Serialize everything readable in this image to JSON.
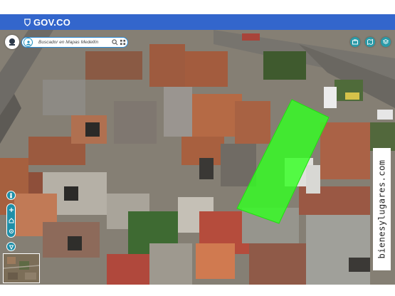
{
  "gov_bar": {
    "logo_text": "GOV.CO",
    "color": "#3366cc",
    "icon": "shield-icon"
  },
  "search": {
    "placeholder": "Buscador en Mapas Medellín",
    "left_icon": "user-icon",
    "search_icon": "search-icon",
    "menu_icon": "grid-menu-icon"
  },
  "map": {
    "type": "aerial-satellite",
    "highlight_color": "#33ff22"
  },
  "tools": [
    "briefcase-icon",
    "map-icon",
    "layers-icon"
  ],
  "controls": [
    "person-icon",
    "zoom-in-icon",
    "home-icon",
    "locate-icon",
    "compass-icon"
  ],
  "watermark": {
    "text": "bienesylugares.com"
  }
}
